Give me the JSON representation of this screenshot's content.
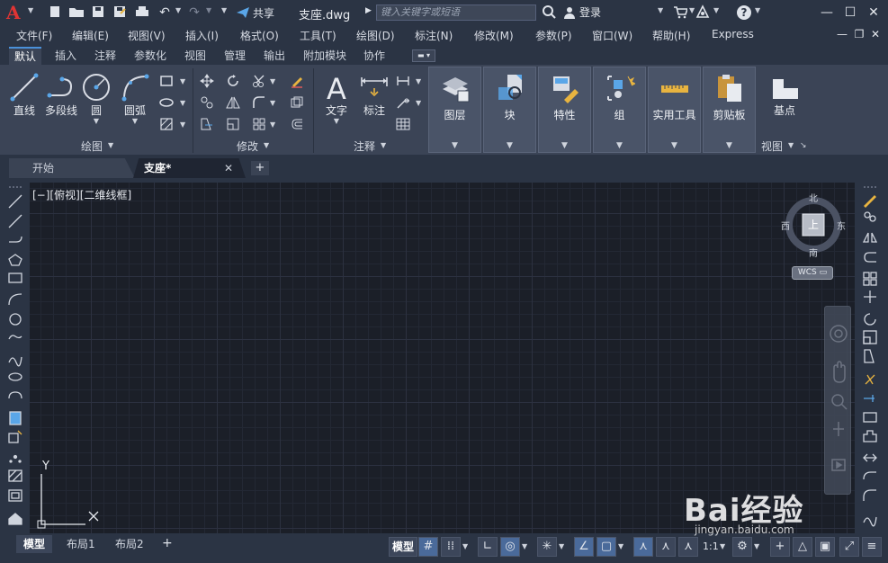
{
  "colors": {
    "accent": "#4a90d9",
    "logo": "#e03434",
    "canvas": "#1b1f28"
  },
  "titlebar": {
    "share_label": "共享",
    "document_title": "支座.dwg",
    "search_placeholder": "键入关键字或短语",
    "login_label": "登录"
  },
  "menu": [
    "文件(F)",
    "编辑(E)",
    "视图(V)",
    "插入(I)",
    "格式(O)",
    "工具(T)",
    "绘图(D)",
    "标注(N)",
    "修改(M)",
    "参数(P)",
    "窗口(W)",
    "帮助(H)",
    "Express"
  ],
  "ribbon_tabs": [
    "默认",
    "插入",
    "注释",
    "参数化",
    "视图",
    "管理",
    "输出",
    "附加模块",
    "协作"
  ],
  "ribbon_active_tab": "默认",
  "draw_panel": {
    "title": "绘图",
    "tools": [
      "直线",
      "多段线",
      "圆",
      "圆弧"
    ]
  },
  "modify_panel": {
    "title": "修改"
  },
  "annotate_panel": {
    "title": "注释",
    "tools": [
      "文字",
      "标注"
    ]
  },
  "big_panels": [
    "图层",
    "块",
    "特性",
    "组",
    "实用工具",
    "剪贴板"
  ],
  "view_panel": {
    "tool": "基点",
    "title": "视图"
  },
  "doc_tabs": {
    "start": "开始",
    "active": "支座*"
  },
  "viewport_label": "[−][俯视][二维线框]",
  "viewcube": {
    "north": "北",
    "south": "南",
    "east": "东",
    "west": "西",
    "top": "上",
    "wcs": "WCS"
  },
  "ucs": {
    "y": "Y",
    "x": "X"
  },
  "layout_tabs": [
    "模型",
    "布局1",
    "布局2"
  ],
  "status": {
    "model_label": "模型",
    "scale": "1:1"
  },
  "watermark": {
    "brand": "Bai经验",
    "url": "jingyan.baidu.com"
  }
}
